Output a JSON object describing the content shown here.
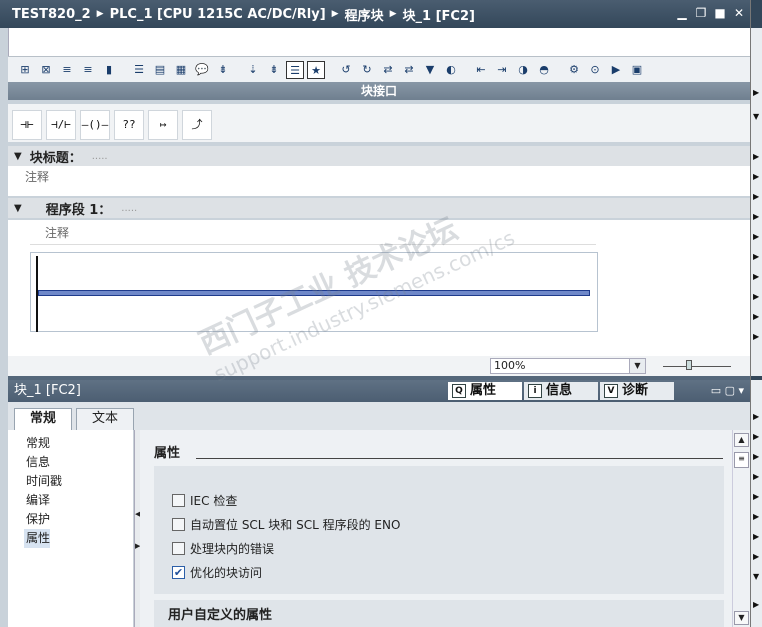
{
  "titlebar": {
    "crumbs": [
      "TEST820_2",
      "PLC_1 [CPU 1215C AC/DC/Rly]",
      "程序块",
      "块_1 [FC2]"
    ],
    "sep": "▶"
  },
  "window_buttons": [
    "▁",
    "❐",
    "■",
    "✕"
  ],
  "toolbar": {
    "buttons": [
      "⊞",
      "⊠",
      "≡",
      "≡",
      "▮",
      "☰",
      "▤",
      "▦",
      "💬",
      "⇟",
      "⇣",
      "⇟",
      "☰",
      "★",
      "↺",
      "↻",
      "⇄",
      "⇄",
      "▼",
      "◐",
      "⇤",
      "⇥",
      "◑",
      "◓",
      "⚙",
      "⊙",
      "▶",
      "▣"
    ]
  },
  "block_interface": {
    "label": "块接口"
  },
  "lad_buttons": [
    "⊣⊢",
    "⊣/⊢",
    "—()—",
    "??",
    "↦",
    "⤴"
  ],
  "block_title": {
    "label": "块标题：",
    "dots": "....."
  },
  "block_comment": "注释",
  "segment": {
    "label": "程序段 1：",
    "dots": "....."
  },
  "segment_comment": "注释",
  "zoom": {
    "value": "100%"
  },
  "inspector": {
    "title": "块_1 [FC2]",
    "tabs": [
      {
        "label": "属性",
        "icon": "Q"
      },
      {
        "label": "信息",
        "icon": "i"
      },
      {
        "label": "诊断",
        "icon": "V"
      }
    ],
    "subtabs": [
      "常规",
      "文本"
    ],
    "nav": [
      "常规",
      "信息",
      "时间戳",
      "编译",
      "保护",
      "属性"
    ],
    "selected_nav": "属性",
    "section_title": "属性",
    "checkboxes": [
      {
        "label": "IEC 检查",
        "checked": false
      },
      {
        "label": "自动置位 SCL 块和 SCL 程序段的 ENO",
        "checked": false
      },
      {
        "label": "处理块内的错误",
        "checked": false
      },
      {
        "label": "优化的块访问",
        "checked": true
      }
    ],
    "user_section_title": "用户自定义的属性"
  },
  "watermark": {
    "line1": "西门子工业 技术论坛",
    "line2": "support.industry.siemens.com/cs"
  }
}
